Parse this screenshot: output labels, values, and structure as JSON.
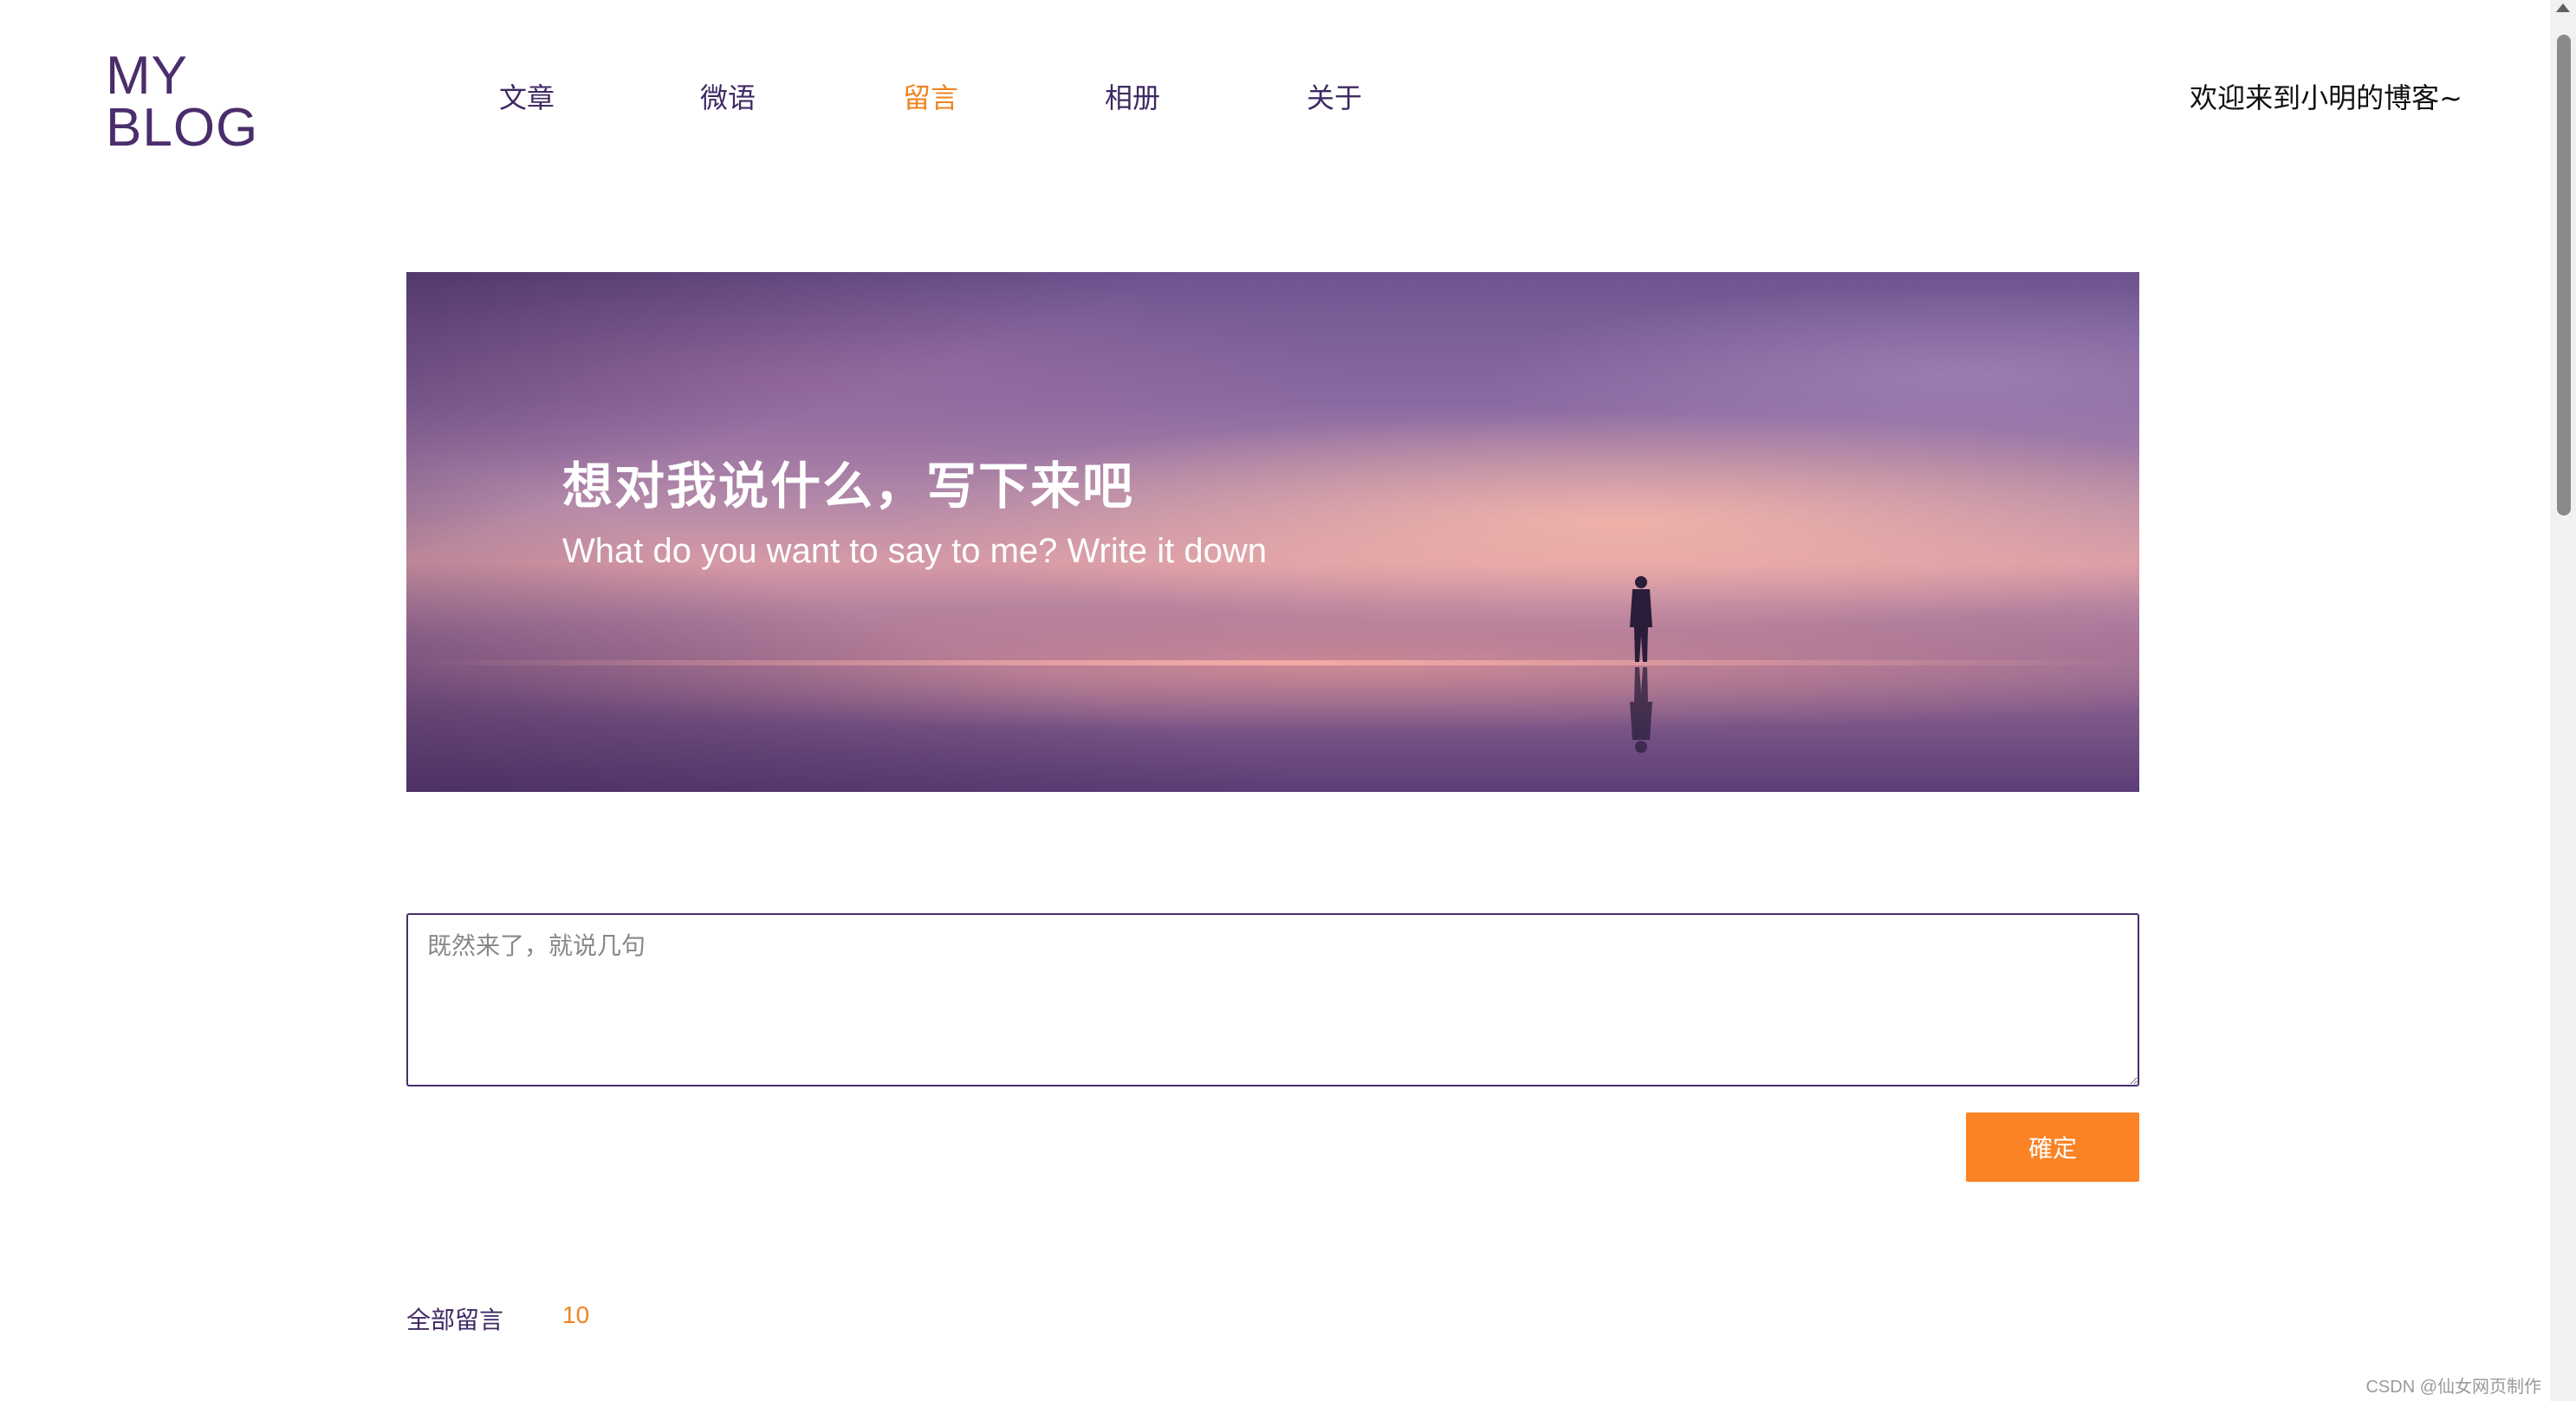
{
  "header": {
    "logo_line1": "MY",
    "logo_line2": "BLOG",
    "nav": [
      {
        "label": "文章",
        "active": false
      },
      {
        "label": "微语",
        "active": false
      },
      {
        "label": "留言",
        "active": true
      },
      {
        "label": "相册",
        "active": false
      },
      {
        "label": "关于",
        "active": false
      }
    ],
    "welcome": "欢迎来到小明的博客~"
  },
  "banner": {
    "title": "想对我说什么，写下来吧",
    "subtitle": "What do you want to say to me? Write it down"
  },
  "message_form": {
    "placeholder": "既然来了，就说几句",
    "value": "",
    "submit_label": "確定"
  },
  "messages": {
    "label": "全部留言",
    "count": "10"
  },
  "watermark": "CSDN @仙女网页制作",
  "colors": {
    "brand": "#4a2d6b",
    "accent": "#f08321",
    "button": "#fb8225"
  }
}
